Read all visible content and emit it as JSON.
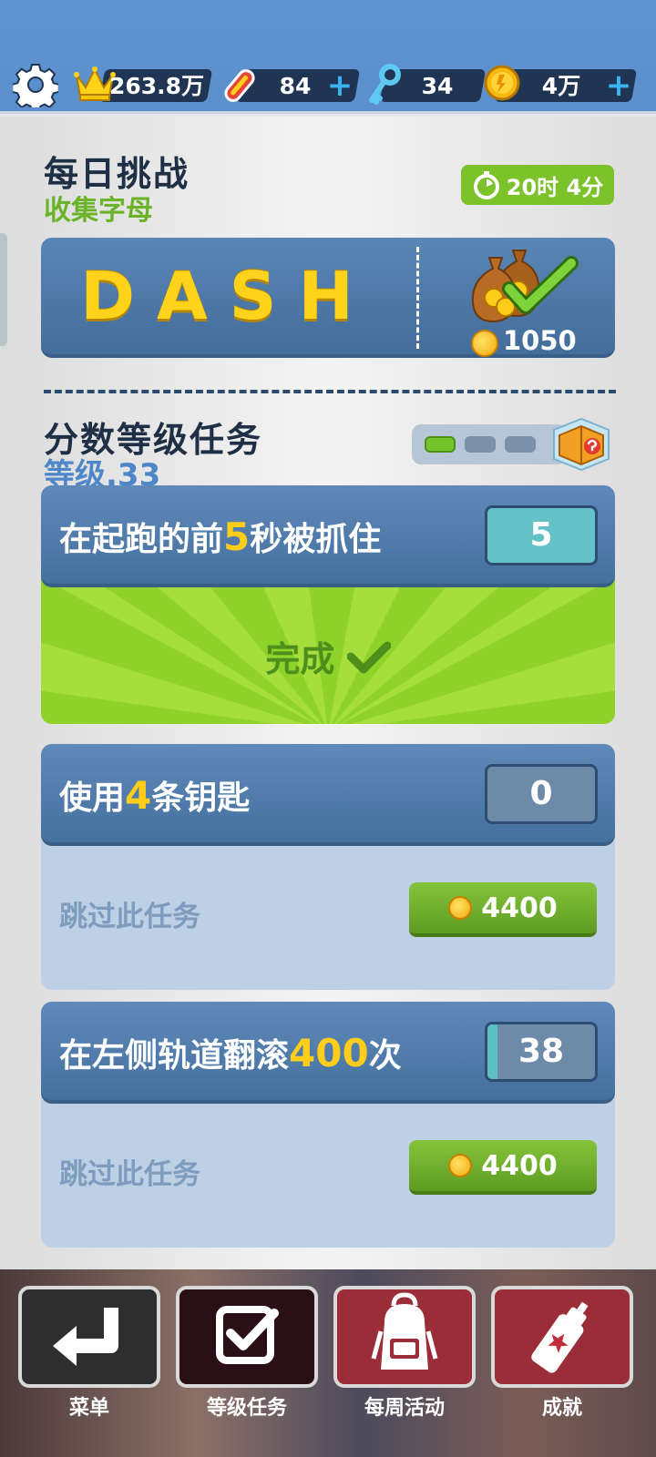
{
  "colors": {
    "top_bar": "#5b8fcb",
    "pill": "#1f3553",
    "plus": "#39b4f0",
    "green": "#7cc22a",
    "card_blue": "#44709e",
    "highlight": "#ffcd1a",
    "skip_text": "#7f9bbd"
  },
  "resources": {
    "score": "263.8万",
    "hoverboards": "84",
    "keys": "34",
    "coins": "4万",
    "plus_symbol": "+"
  },
  "daily": {
    "title": "每日挑战",
    "subtitle": "收集字母",
    "timer": "20时 4分",
    "word": "DASH",
    "reward": "1050"
  },
  "score_missions": {
    "title": "分数等级任务",
    "level": "等级.33",
    "progress": {
      "completed": 1,
      "total": 3
    },
    "missions": [
      {
        "pre": "在起跑的前",
        "num": "5",
        "post": "秒被抓住",
        "count": "5",
        "progress": 1.0,
        "status": "完成"
      },
      {
        "pre": "使用",
        "num": "4",
        "post": "条钥匙",
        "count": "0",
        "progress": 0.0,
        "skip_label": "跳过此任务",
        "skip_cost": "4400"
      },
      {
        "pre": "在左侧轨道翻滚",
        "num": "400",
        "post": "次",
        "count": "38",
        "progress": 0.095,
        "skip_label": "跳过此任务",
        "skip_cost": "4400"
      }
    ]
  },
  "nav": {
    "menu": "菜单",
    "level_missions": "等级任务",
    "weekly": "每周活动",
    "achievements": "成就"
  }
}
